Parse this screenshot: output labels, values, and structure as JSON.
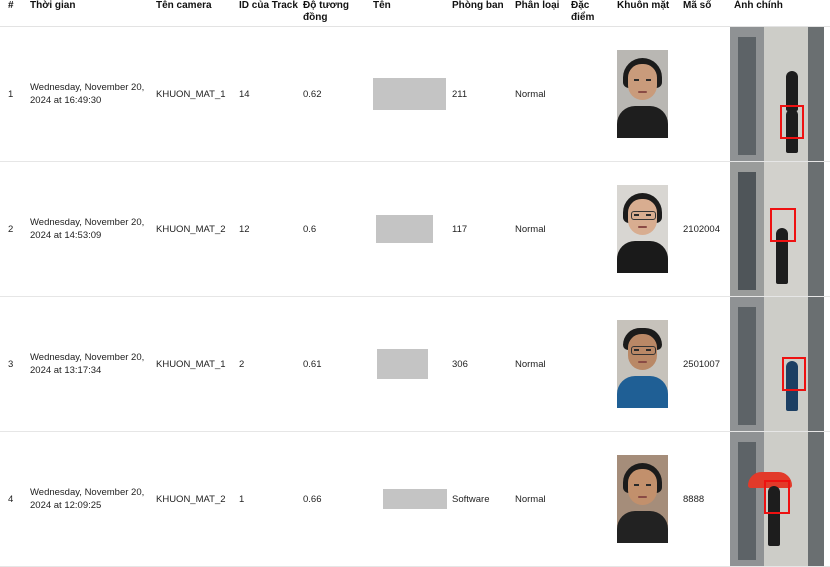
{
  "columns": {
    "idx": "#",
    "time": "Thời gian",
    "camera": "Tên camera",
    "track_id": "ID của Track",
    "similarity": "Độ tương đồng",
    "name": "Tên",
    "department": "Phòng ban",
    "category": "Phân loại",
    "features": "Đặc điểm",
    "face": "Khuôn mặt",
    "code": "Mã số",
    "main_image": "Ảnh chính"
  },
  "rows": [
    {
      "idx": "1",
      "time": "Wednesday, November 20, 2024 at 16:49:30",
      "camera": "KHUON_MAT_1",
      "track_id": "14",
      "similarity": "0.62",
      "department": "211",
      "category": "Normal",
      "features": "",
      "code": ""
    },
    {
      "idx": "2",
      "time": "Wednesday, November 20, 2024 at 14:53:09",
      "camera": "KHUON_MAT_2",
      "track_id": "12",
      "similarity": "0.6",
      "department": "117",
      "category": "Normal",
      "features": "",
      "code": "2102004"
    },
    {
      "idx": "3",
      "time": "Wednesday, November 20, 2024 at 13:17:34",
      "camera": "KHUON_MAT_1",
      "track_id": "2",
      "similarity": "0.61",
      "department": "306",
      "category": "Normal",
      "features": "",
      "code": "2501007"
    },
    {
      "idx": "4",
      "time": "Wednesday, November 20, 2024 at 12:09:25",
      "camera": "KHUON_MAT_2",
      "track_id": "1",
      "similarity": "0.66",
      "department": "Software",
      "category": "Normal",
      "features": "",
      "code": "8888"
    }
  ],
  "colors": {
    "redacted_name": "#c4c4c4",
    "bbox": "#ee1111",
    "row_divider": "#e6e6e6"
  },
  "icons": {
    "face_thumbnail": "face-crop-image",
    "main_image": "camera-frame-image"
  }
}
